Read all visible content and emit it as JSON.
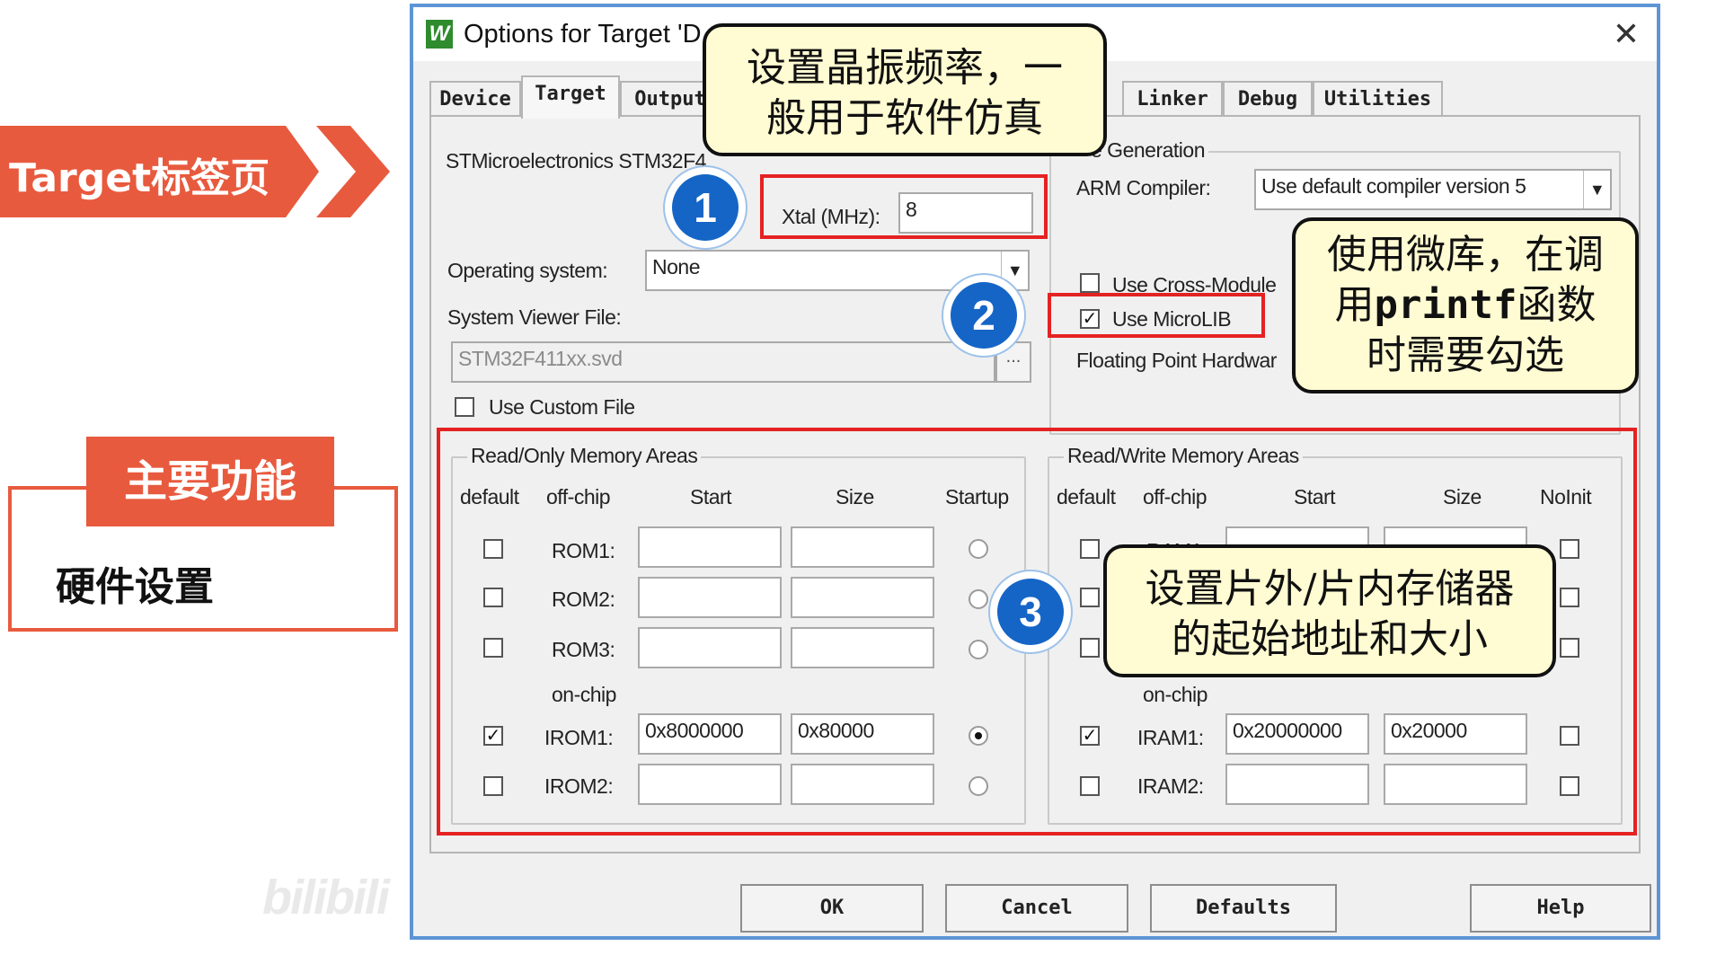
{
  "slide": {
    "banner": "Target标签页",
    "feature_tag": "主要功能",
    "feature_item": "硬件设置",
    "watermark": "bilibili"
  },
  "dialog": {
    "title": "Options for Target 'D",
    "icon": "keil-uvision-icon",
    "close_label": "✕",
    "tabs": [
      "Device",
      "Target",
      "Output",
      "Linker",
      "Debug",
      "Utilities"
    ],
    "active_tab": "Target",
    "device_name": "STMicroelectronics STM32F4",
    "xtal_label": "Xtal (MHz):",
    "xtal_value": "8",
    "os_label": "Operating system:",
    "os_value": "None",
    "svd_label": "System Viewer File:",
    "svd_value": "STM32F411xx.svd",
    "browse_label": "...",
    "use_custom_file": {
      "label": "Use Custom File",
      "checked": false
    },
    "code_gen": {
      "title": "e Generation",
      "compiler_label": "ARM Compiler:",
      "compiler_value": "Use default compiler version 5",
      "cross_module_label": "Use Cross-Module",
      "cross_module_checked": false,
      "microlib_label": "Use MicroLIB",
      "microlib_checked": true,
      "fpu_label": "Floating Point Hardwar"
    },
    "rom": {
      "title": "Read/Only Memory Areas",
      "headers": [
        "default",
        "off-chip",
        "Start",
        "Size",
        "Startup"
      ],
      "onchip_label": "on-chip",
      "rows": [
        {
          "name": "ROM1:",
          "default": false,
          "start": "",
          "size": "",
          "startup": false
        },
        {
          "name": "ROM2:",
          "default": false,
          "start": "",
          "size": "",
          "startup": false
        },
        {
          "name": "ROM3:",
          "default": false,
          "start": "",
          "size": "",
          "startup": false
        },
        {
          "name": "IROM1:",
          "default": true,
          "start": "0x8000000",
          "size": "0x80000",
          "startup": true
        },
        {
          "name": "IROM2:",
          "default": false,
          "start": "",
          "size": "",
          "startup": false
        }
      ]
    },
    "ram": {
      "title": "Read/Write Memory Areas",
      "headers": [
        "default",
        "off-chip",
        "Start",
        "Size",
        "NoInit"
      ],
      "onchip_label": "on-chip",
      "rows": [
        {
          "name": "RAM1:",
          "default": false,
          "start": "",
          "size": "",
          "noinit": false
        },
        {
          "name": "IRAM1:",
          "default": true,
          "start": "0x20000000",
          "size": "0x20000",
          "noinit": false
        },
        {
          "name": "IRAM2:",
          "default": false,
          "start": "",
          "size": "",
          "noinit": false
        }
      ]
    },
    "buttons": {
      "ok": "OK",
      "cancel": "Cancel",
      "defaults": "Defaults",
      "help": "Help"
    }
  },
  "annotations": {
    "badges": [
      "1",
      "2",
      "3"
    ],
    "callout1": "设置晶振频率，一般用于软件仿真",
    "callout2_pre": "使用微库，在调用",
    "callout2_code": "printf",
    "callout2_post": "函数时需要勾选",
    "callout3": "设置片外/片内存储器的起始地址和大小",
    "highlight_color": "#e52222",
    "badge_color": "#1565c6",
    "callout_bg": "#fffbd2",
    "accent": "#e85a3e"
  }
}
